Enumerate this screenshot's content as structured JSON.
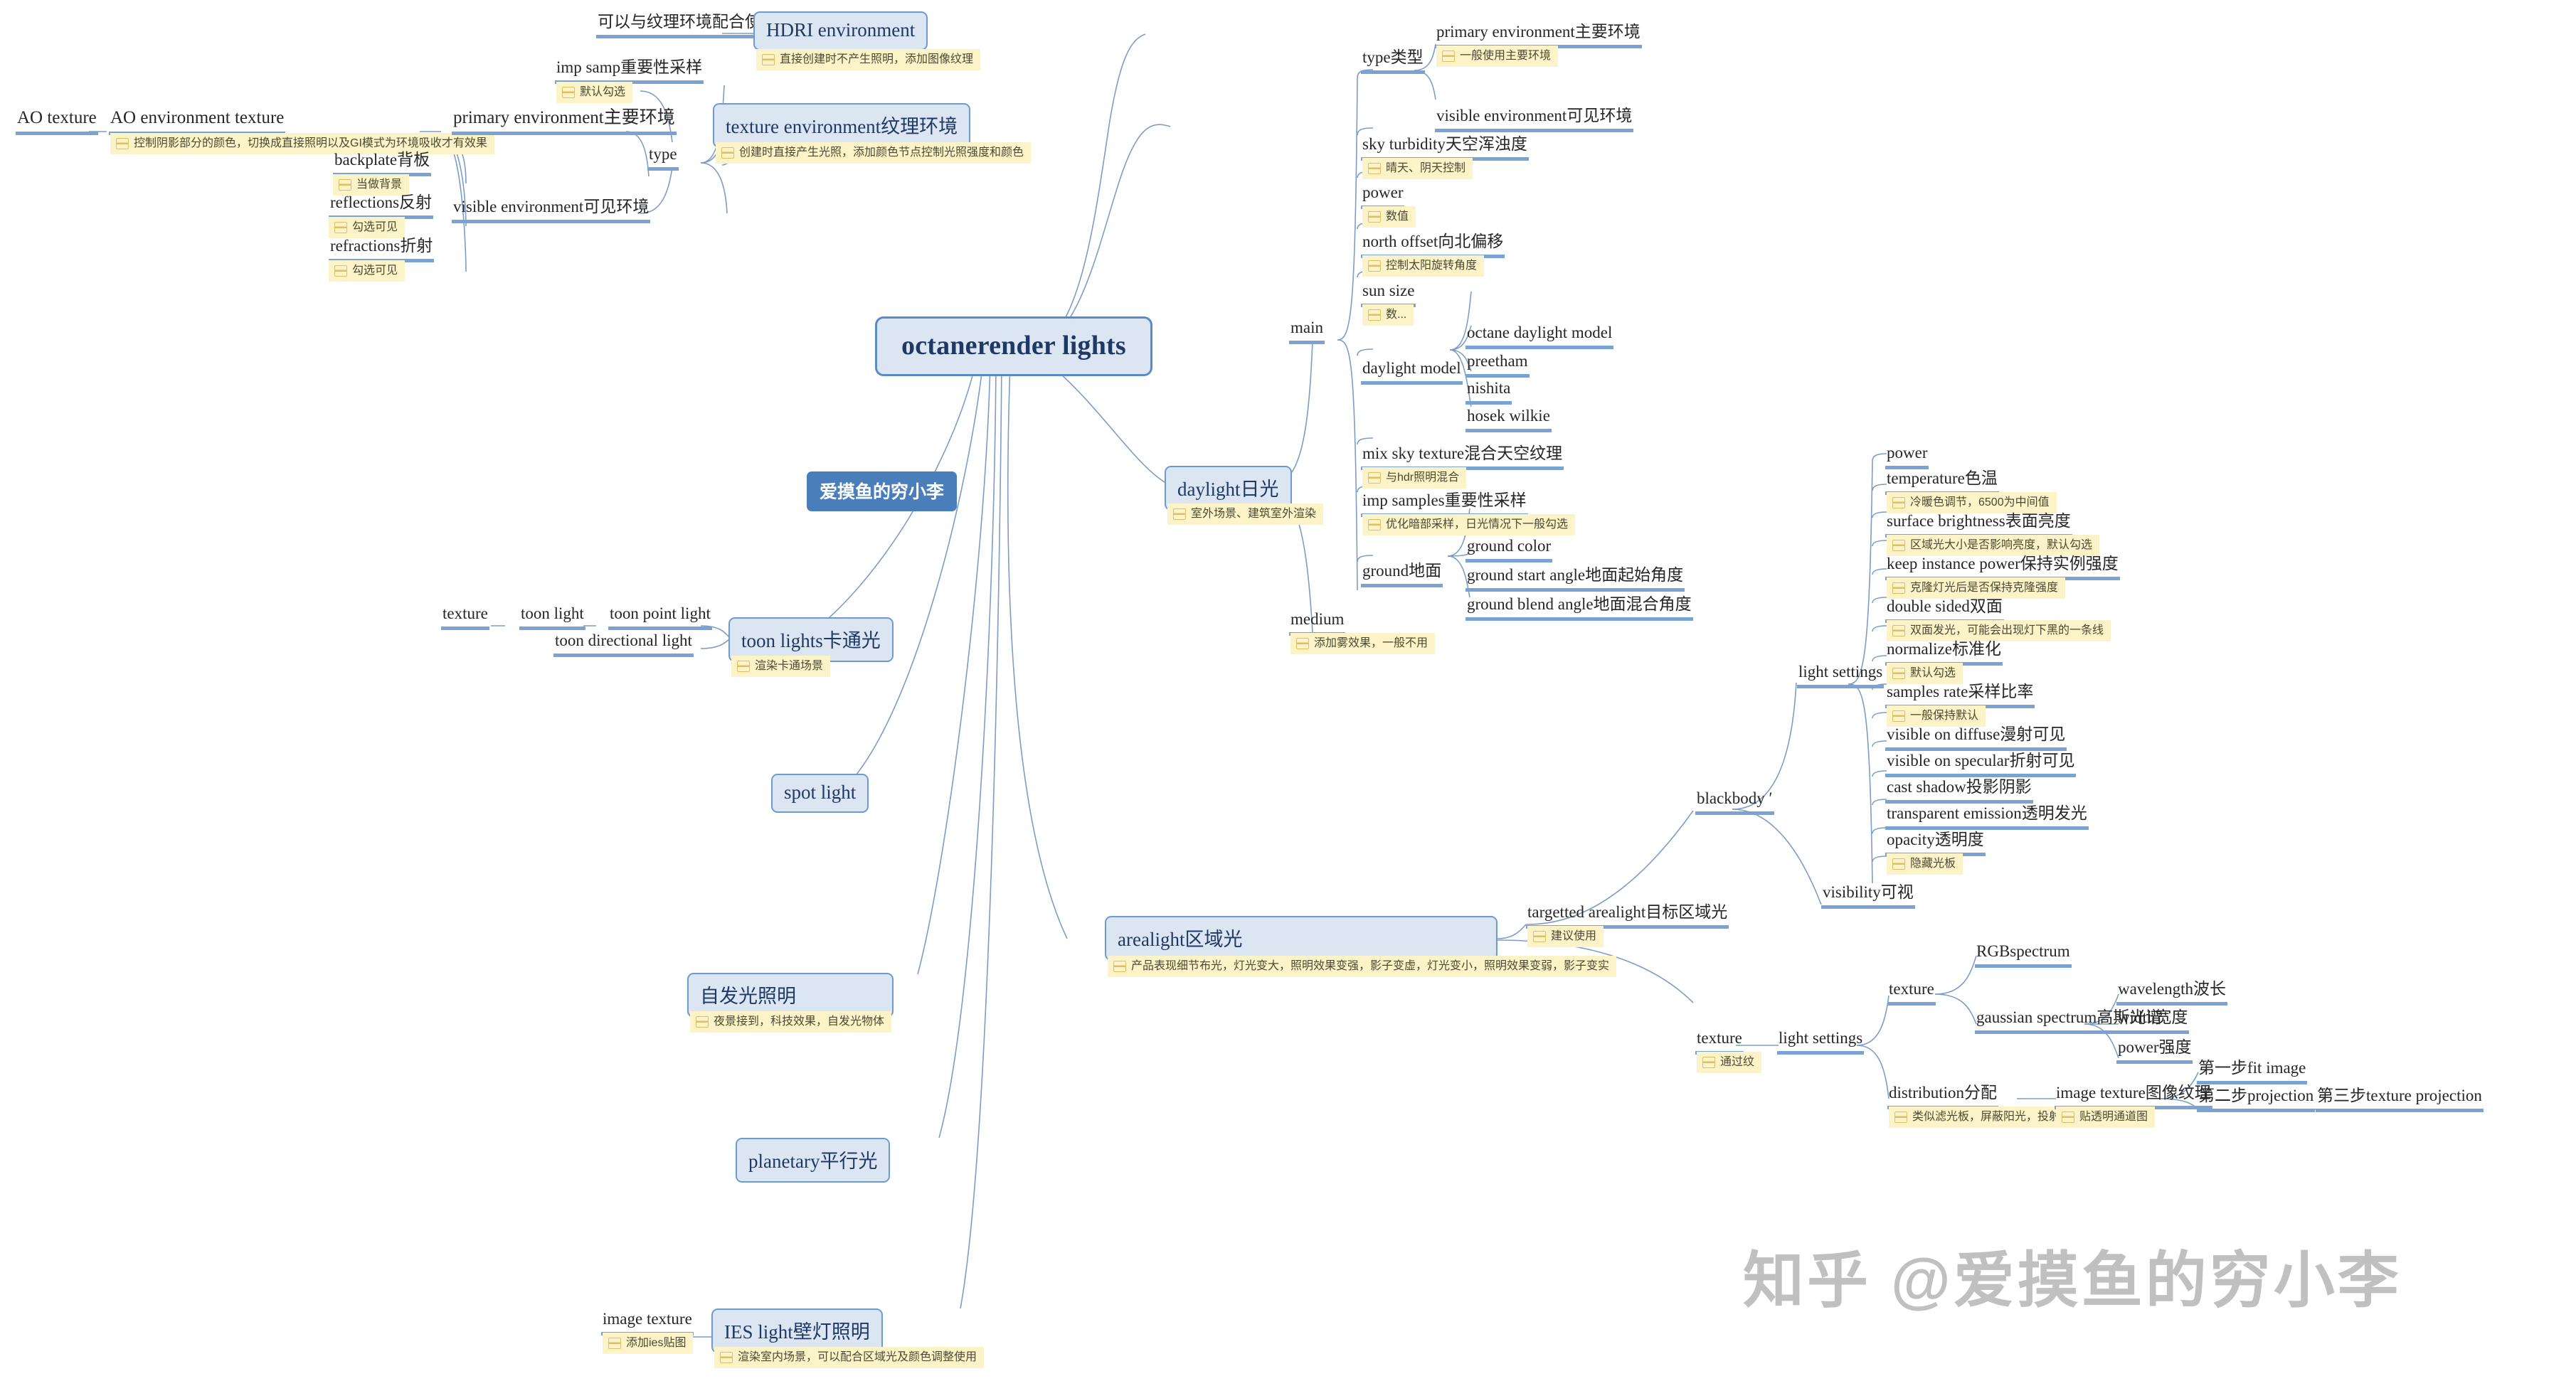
{
  "root": {
    "label": "octanerender lights"
  },
  "author_chip": {
    "label": "爱摸鱼的穷小李"
  },
  "watermark": {
    "text": "知乎 @爱摸鱼的穷小李"
  },
  "branches": {
    "hdri": {
      "title": "HDRI environment",
      "note": "直接创建时不产生照明，添加图像纹理",
      "children": [
        {
          "label": "可以与纹理环境配合使用"
        }
      ]
    },
    "texture_env": {
      "title": "texture environment纹理环境",
      "note": "创建时直接产生光照，添加颜色节点控制光照强度和颜色",
      "type_label": "type",
      "type_children": [
        {
          "label": "imp samp重要性采样",
          "note": "默认勾选"
        },
        {
          "label": "primary environment主要环境"
        },
        {
          "label": "visible environment可见环境"
        }
      ],
      "primary_children": [
        {
          "label": "backplate背板",
          "note": "当做背景"
        },
        {
          "label": "reflections反射",
          "note": "勾选可见"
        },
        {
          "label": "refractions折射",
          "note": "勾选可见"
        }
      ],
      "ao": [
        {
          "label": "AO texture"
        },
        {
          "label": "AO environment texture",
          "note": "控制阴影部分的颜色，切换成直接照明以及GI模式为环境吸收才有效果"
        }
      ]
    },
    "daylight": {
      "title": "daylight日光",
      "note": "室外场景、建筑室外渲染",
      "main_label": "main",
      "medium_label": "medium",
      "medium_note": "添加雾效果，一般不用",
      "main_children": [
        {
          "label": "type类型",
          "children": [
            {
              "label": "primary environment主要环境",
              "note": "一般使用主要环境"
            },
            {
              "label": "visible environment可见环境"
            }
          ]
        },
        {
          "label": "sky turbidity天空浑浊度",
          "note": "晴天、阴天控制"
        },
        {
          "label": "power",
          "note": "数值"
        },
        {
          "label": "north offset向北偏移",
          "note": "控制太阳旋转角度"
        },
        {
          "label": "sun size",
          "note": "数..."
        },
        {
          "label": "daylight model",
          "children": [
            {
              "label": "octane daylight model"
            },
            {
              "label": "preetham"
            },
            {
              "label": "nishita"
            },
            {
              "label": "hosek wilkie"
            }
          ]
        },
        {
          "label": "mix sky texture混合天空纹理",
          "note": "与hdr照明混合"
        },
        {
          "label": "imp samples重要性采样",
          "note": "优化暗部采样，日光情况下一般勾选"
        },
        {
          "label": "ground地面",
          "children": [
            {
              "label": "ground color"
            },
            {
              "label": "ground start angle地面起始角度"
            },
            {
              "label": "ground blend angle地面混合角度"
            }
          ]
        }
      ]
    },
    "toon": {
      "title": "toon lights卡通光",
      "note": "渲染卡通场景",
      "children": [
        {
          "label": "toon point light"
        },
        {
          "label": "toon directional light"
        }
      ],
      "chain": [
        {
          "label": "texture"
        },
        {
          "label": "toon light"
        }
      ]
    },
    "spot": {
      "title": "spot light"
    },
    "arealight": {
      "title": "arealight区域光",
      "note": "产品表现细节布光，灯光变大，照明效果变强，影子变虚，灯光变小，照明效果变弱，影子变实",
      "targetted": {
        "label": "targetted arealight目标区域光",
        "note": "建议使用"
      },
      "blackbody_label": "blackbody ′",
      "light_settings_label": "light settings",
      "visibility_label": "visibility可视",
      "light_settings_children": [
        {
          "label": "power"
        },
        {
          "label": "temperature色温",
          "note": "冷暖色调节，6500为中间值"
        },
        {
          "label": "surface brightness表面亮度",
          "note": "区域光大小是否影响亮度，默认勾选"
        },
        {
          "label": "keep instance power保持实例强度",
          "note": "克隆灯光后是否保持克隆强度"
        },
        {
          "label": "double sided双面",
          "note": "双面发光，可能会出现灯下黑的一条线"
        },
        {
          "label": "normalize标准化",
          "note": "默认勾选"
        },
        {
          "label": "samples rate采样比率",
          "note": "一般保持默认"
        },
        {
          "label": "visible on diffuse漫射可见"
        },
        {
          "label": "visible on specular折射可见"
        },
        {
          "label": "cast shadow投影阴影"
        },
        {
          "label": "transparent emission透明发光"
        },
        {
          "label": "opacity透明度",
          "note": "隐藏光板"
        }
      ],
      "texture_label": "texture",
      "texture_note": "通过纹",
      "texture_settings_label": "light settings",
      "texture_branch_label": "texture",
      "texture_children": [
        {
          "label": "RGBspectrum"
        },
        {
          "label": "gaussian spectrum高斯光谱",
          "children": [
            {
              "label": "wavelength波长"
            },
            {
              "label": "width宽度"
            },
            {
              "label": "power强度"
            }
          ]
        }
      ],
      "distribution": {
        "label": "distribution分配",
        "note": "类似滤光板，屏蔽阳光，投射影子"
      },
      "image_texture": {
        "label": "image texture图像纹理",
        "note": "贴透明通道图",
        "steps": [
          {
            "label": "第一步fit image"
          },
          {
            "label": "第二步projection"
          },
          {
            "label": "第三步texture projection"
          }
        ]
      }
    },
    "emissive": {
      "title": "自发光照明",
      "note": "夜景接到，科技效果，自发光物体"
    },
    "planetary": {
      "title": "planetary平行光"
    },
    "ies": {
      "title": "IES light壁灯照明",
      "note": "渲染室内场景，可以配合区域光及颜色调整使用",
      "image_texture": {
        "label": "image texture",
        "note": "添加ies贴图"
      }
    }
  }
}
